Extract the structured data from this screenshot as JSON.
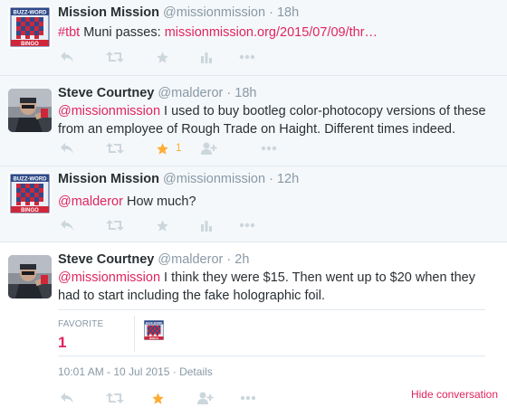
{
  "colors": {
    "accent": "#e0245e",
    "favorite": "#ffac33",
    "muted": "#8899a6",
    "icon": "#ccd6dd"
  },
  "tweets": [
    {
      "fullname": "Mission Mission",
      "screenname": "@missionmission",
      "separator": "·",
      "time": "18h",
      "hashtag": "#tbt",
      "text": " Muni passes: ",
      "url": "missionmission.org/2015/07/09/thr…",
      "avatar_icon": "buzzword-bingo-avatar",
      "actions": [
        "reply-icon",
        "retweet-icon",
        "favorite-icon",
        "stats-icon",
        "more-icon"
      ]
    },
    {
      "fullname": "Steve Courtney",
      "screenname": "@malderor",
      "separator": "·",
      "time": "18h",
      "mention": "@missionmission",
      "text": " I used to buy bootleg color-photocopy versions of these from an employee of Rough Trade on Haight. Different times indeed.",
      "favorite_count": "1",
      "avatar_icon": "person-photo-avatar",
      "actions": [
        "reply-icon",
        "retweet-icon",
        "favorite-icon",
        "follow-icon",
        "more-icon"
      ]
    },
    {
      "fullname": "Mission Mission",
      "screenname": "@missionmission",
      "separator": "·",
      "time": "12h",
      "mention": "@malderor",
      "text": " How much?",
      "avatar_icon": "buzzword-bingo-avatar",
      "actions": [
        "reply-icon",
        "retweet-icon",
        "favorite-icon",
        "stats-icon",
        "more-icon"
      ]
    },
    {
      "fullname": "Steve Courtney",
      "screenname": "@malderor",
      "separator": "·",
      "time": "2h",
      "mention": "@missionmission",
      "text": " I think they were $15. Then went up to $20 when they had to start including the fake holographic foil.",
      "favorite_label": "FAVORITE",
      "favorite_value": "1",
      "timestamp": "10:01 AM - 10 Jul 2015",
      "details_sep": " · ",
      "details_link": "Details",
      "hide_conversation": "Hide conversation",
      "avatar_icon": "person-photo-avatar",
      "actions": [
        "reply-icon",
        "retweet-icon",
        "favorite-icon",
        "follow-icon",
        "more-icon"
      ]
    }
  ]
}
